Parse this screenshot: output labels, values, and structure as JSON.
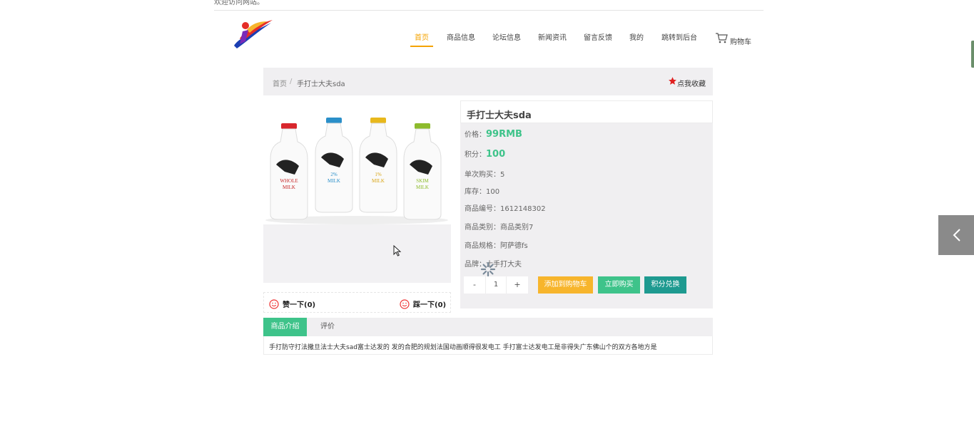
{
  "topbar": {
    "welcome": "欢迎访问网站。"
  },
  "nav": [
    {
      "label": "首页",
      "active": true
    },
    {
      "label": "商品信息"
    },
    {
      "label": "论坛信息"
    },
    {
      "label": "新闻资讯"
    },
    {
      "label": "留言反馈"
    },
    {
      "label": "我的"
    },
    {
      "label": "跳转到后台"
    }
  ],
  "cart": {
    "label": "购物车",
    "icon": "cart-icon"
  },
  "breadcrumb": {
    "home": "首页",
    "sep": "/",
    "current": "手打士大夫sda"
  },
  "favorite": {
    "label": "点我收藏",
    "icon": "star-icon",
    "color": "#e02020"
  },
  "product": {
    "title": "手打士大夫sda",
    "price_label": "价格：",
    "price": "99RMB",
    "points_label": "积分：",
    "points": "100",
    "single_buy": "单次购买：5",
    "stock": "库存：100",
    "code": "商品编号：1612148302",
    "category": "商品类别：商品类别7",
    "spec": "商品规格：阿萨德fs",
    "brand": "品牌：士手打大夫"
  },
  "vote": {
    "like": "赞一下(0)",
    "dislike": "踩一下(0)"
  },
  "quantity": {
    "minus": "-",
    "value": "1",
    "plus": "+"
  },
  "buttons": {
    "add_cart": "添加到购物车",
    "buy_now": "立即购买",
    "points_exchange": "积分兑换"
  },
  "tabs": [
    {
      "label": "商品介绍",
      "active": true
    },
    {
      "label": "评价"
    }
  ],
  "description": "手打防守打法撒旦法士大夫sad富士达发的 发的合肥的规划法国动画顺得很发电工 手打富士达发电工是非得失广东佛山个的双方各地方是",
  "colors": {
    "accent": "#f4a300",
    "green": "#3ec38a",
    "teal": "#1e9a90",
    "orange": "#f7b52c"
  }
}
